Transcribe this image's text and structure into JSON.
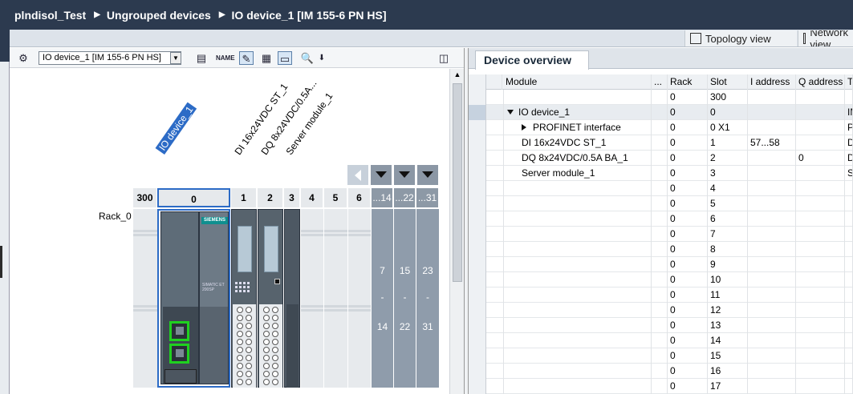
{
  "breadcrumb": {
    "project": "plndisol_Test",
    "group": "Ungrouped devices",
    "device": "IO device_1 [IM 155-6 PN HS]"
  },
  "view_tabs": {
    "topology": "Topology view",
    "network": "Network view"
  },
  "toolbar": {
    "device_select": "IO device_1 [IM 155-6 PN HS]"
  },
  "device_view": {
    "module_labels": [
      "IO device_1",
      "DI 16x24VDC ST_1",
      "DQ 8x24VDC/0.5A...",
      "Server module_1"
    ],
    "slots": [
      "300",
      "0",
      "1",
      "2",
      "3",
      "4",
      "5",
      "6",
      "...14",
      "...22",
      "...31"
    ],
    "rack_label": "Rack_0",
    "ranges": [
      {
        "from": "7",
        "dash": "-",
        "to": "14"
      },
      {
        "from": "15",
        "dash": "-",
        "to": "22"
      },
      {
        "from": "23",
        "dash": "-",
        "to": "31"
      }
    ],
    "brand": "SIEMENS",
    "module_text": "SIMATIC ET 200SP"
  },
  "device_overview": {
    "tab": "Device overview",
    "columns": [
      "Module",
      "...",
      "Rack",
      "Slot",
      "I address",
      "Q address",
      "T"
    ],
    "rows": [
      {
        "module": "",
        "rack": "0",
        "slot": "300",
        "i": "",
        "q": "",
        "t": ""
      },
      {
        "module": "IO device_1",
        "rack": "0",
        "slot": "0",
        "i": "",
        "q": "",
        "t": "IM"
      },
      {
        "module": "PROFINET interface",
        "rack": "0",
        "slot": "0 X1",
        "i": "",
        "q": "",
        "t": "P"
      },
      {
        "module": "DI 16x24VDC ST_1",
        "rack": "0",
        "slot": "1",
        "i": "57...58",
        "q": "",
        "t": "D"
      },
      {
        "module": "DQ 8x24VDC/0.5A BA_1",
        "rack": "0",
        "slot": "2",
        "i": "",
        "q": "0",
        "t": "D"
      },
      {
        "module": "Server module_1",
        "rack": "0",
        "slot": "3",
        "i": "",
        "q": "",
        "t": "S"
      },
      {
        "module": "",
        "rack": "0",
        "slot": "4",
        "i": "",
        "q": "",
        "t": ""
      },
      {
        "module": "",
        "rack": "0",
        "slot": "5",
        "i": "",
        "q": "",
        "t": ""
      },
      {
        "module": "",
        "rack": "0",
        "slot": "6",
        "i": "",
        "q": "",
        "t": ""
      },
      {
        "module": "",
        "rack": "0",
        "slot": "7",
        "i": "",
        "q": "",
        "t": ""
      },
      {
        "module": "",
        "rack": "0",
        "slot": "8",
        "i": "",
        "q": "",
        "t": ""
      },
      {
        "module": "",
        "rack": "0",
        "slot": "9",
        "i": "",
        "q": "",
        "t": ""
      },
      {
        "module": "",
        "rack": "0",
        "slot": "10",
        "i": "",
        "q": "",
        "t": ""
      },
      {
        "module": "",
        "rack": "0",
        "slot": "11",
        "i": "",
        "q": "",
        "t": ""
      },
      {
        "module": "",
        "rack": "0",
        "slot": "12",
        "i": "",
        "q": "",
        "t": ""
      },
      {
        "module": "",
        "rack": "0",
        "slot": "13",
        "i": "",
        "q": "",
        "t": ""
      },
      {
        "module": "",
        "rack": "0",
        "slot": "14",
        "i": "",
        "q": "",
        "t": ""
      },
      {
        "module": "",
        "rack": "0",
        "slot": "15",
        "i": "",
        "q": "",
        "t": ""
      },
      {
        "module": "",
        "rack": "0",
        "slot": "16",
        "i": "",
        "q": "",
        "t": ""
      },
      {
        "module": "",
        "rack": "0",
        "slot": "17",
        "i": "",
        "q": "",
        "t": ""
      }
    ]
  },
  "colors": {
    "title_bg": "#2c3a4f",
    "selection": "#2c6bc6",
    "port_highlight": "#1fd11f"
  }
}
